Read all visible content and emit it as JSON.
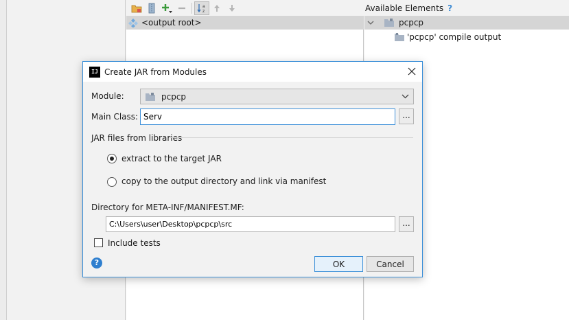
{
  "ide": {
    "layout_tree": {
      "root_label": "<output root>"
    },
    "available": {
      "header": "Available Elements",
      "help_glyph": "?",
      "tree": {
        "module_label": "pcpcp",
        "child_label": "'pcpcp' compile output"
      }
    }
  },
  "dialog": {
    "app_icon_text": "IJ",
    "title": "Create JAR from Modules",
    "module": {
      "label": "Module:",
      "value": "pcpcp"
    },
    "main_class": {
      "label": "Main Class:",
      "value": "Serv",
      "browse_label": "..."
    },
    "jar_section": {
      "title": "JAR files from libraries",
      "options": [
        {
          "label": "extract to the target JAR",
          "selected": true
        },
        {
          "label": "copy to the output directory and link via manifest",
          "selected": false
        }
      ]
    },
    "manifest": {
      "label": "Directory for META-INF/MANIFEST.MF:",
      "value": "C:\\Users\\user\\Desktop\\pcpcp\\src",
      "browse_label": "..."
    },
    "include_tests": {
      "label": "Include tests",
      "checked": false
    },
    "help_glyph": "?",
    "buttons": {
      "ok": "OK",
      "cancel": "Cancel"
    }
  },
  "colors": {
    "accent": "#3b8fd8",
    "selection_row": "#d5d5d5",
    "dialog_bg": "#f2f2f2",
    "add_green": "#3a9a3a"
  }
}
